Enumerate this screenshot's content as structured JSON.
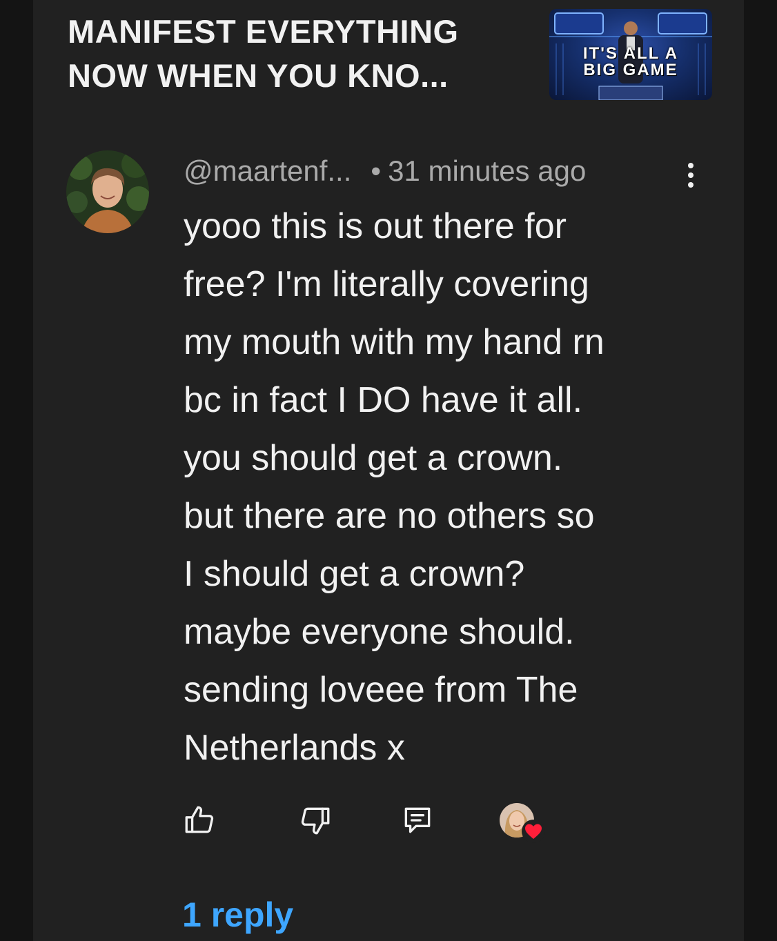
{
  "video": {
    "title": "MANIFEST EVERYTHING\nNOW WHEN YOU KNO...",
    "thumbnail": {
      "line1": "IT'S ALL A",
      "line2": "BIG GAME"
    }
  },
  "comment": {
    "author": "@maartenf...",
    "separator": "•",
    "time": "31 minutes ago",
    "text": "yooo this is out there for\nfree? I'm literally covering\nmy mouth with my hand rn\nbc in fact I DO have it all.\nyou should get a crown.\nbut there are no others so\nI should get a crown?\nmaybe everyone should.\nsending loveee from The\nNetherlands x",
    "actions": {
      "like_icon": "thumbs-up-icon",
      "dislike_icon": "thumbs-down-icon",
      "reply_icon": "reply-comment-icon",
      "creator_heart_icon": "creator-heart-icon"
    },
    "replies_label": "1 reply"
  },
  "colors": {
    "background": "#212121",
    "text": "#f1f1f1",
    "secondary_text": "#aaaaaa",
    "link": "#3ea6ff",
    "heart": "#ff1f3a"
  }
}
